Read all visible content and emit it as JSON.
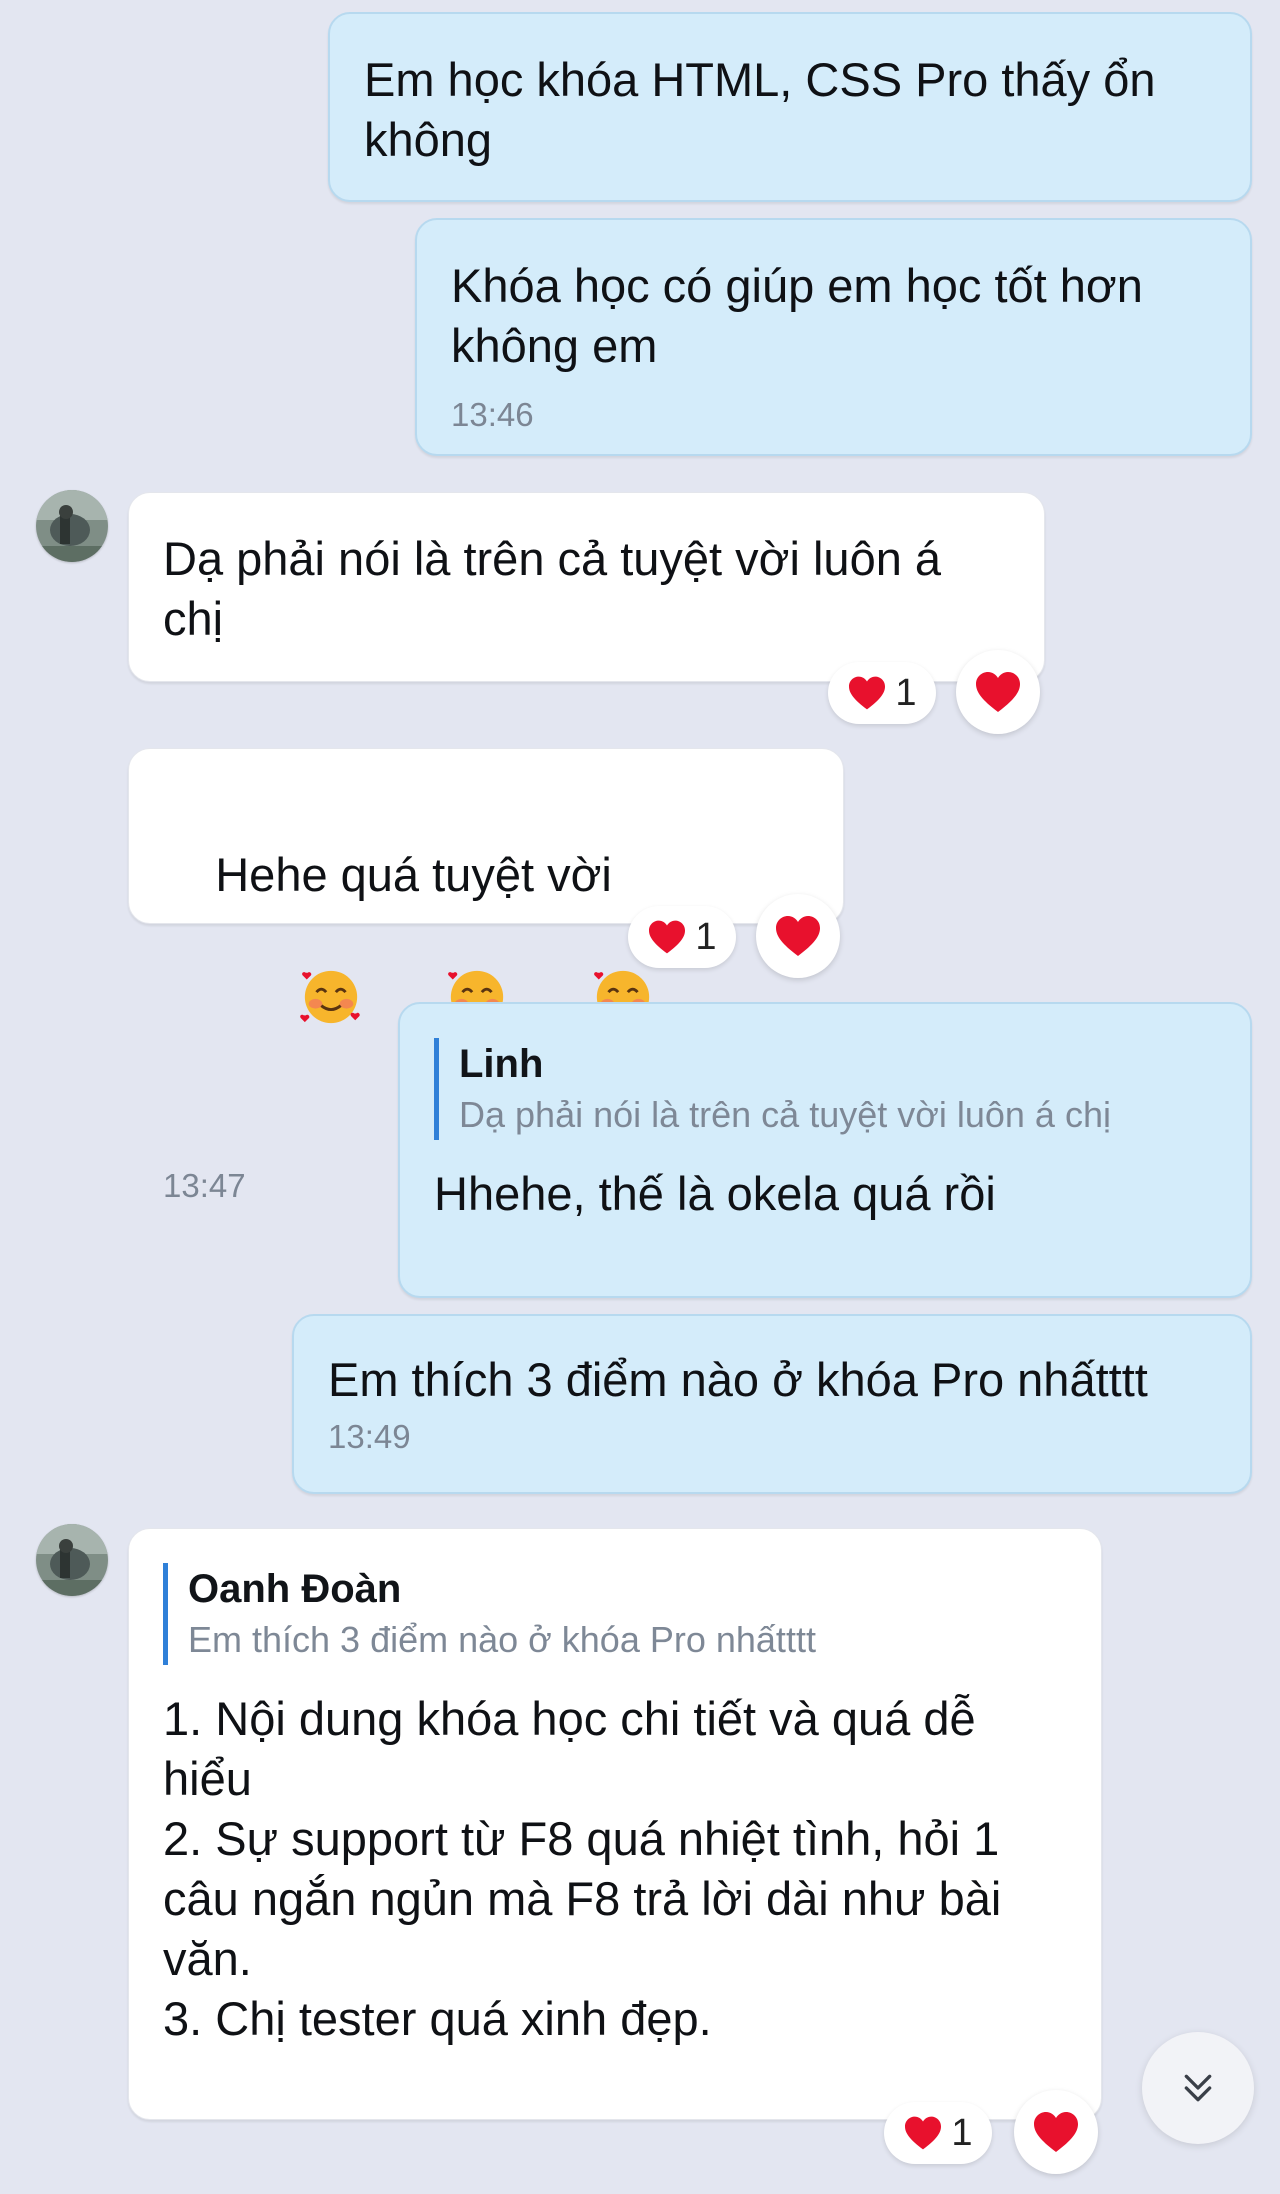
{
  "messages": {
    "m1": {
      "text": "Em học khóa HTML, CSS Pro thấy ổn\nkhông"
    },
    "m2": {
      "text": "Khóa học có giúp em học tốt hơn\nkhông em",
      "time": "13:46"
    },
    "m3": {
      "text": "Dạ phải nói là trên cả tuyệt vời luôn á\nchị",
      "reaction_count": "1"
    },
    "m4": {
      "text": "Hehe quá tuyệt vời",
      "emoji": "smiling-face-with-hearts-icon",
      "time": "13:47",
      "reaction_count": "1"
    },
    "m5": {
      "quote_name": "Linh",
      "quote_text": "Dạ phải nói là trên cả tuyệt vời luôn á chị",
      "text": "Hhehe, thế là okela quá rồi"
    },
    "m6": {
      "text": "Em thích 3 điểm nào ở khóa Pro nhấtttt",
      "time": "13:49"
    },
    "m7": {
      "quote_name": "Oanh Đoàn",
      "quote_text": "Em thích 3 điểm nào ở khóa Pro nhấtttt",
      "text": "1. Nội dung khóa học chi tiết và quá dễ\nhiểu\n2. Sự support từ F8 quá nhiệt tình, hỏi 1\ncâu ngắn ngủn mà F8 trả lời dài như bài\nvăn.\n3. Chị tester quá xinh đẹp.",
      "reaction_count": "1"
    }
  },
  "icons": {
    "reaction": "heart-icon",
    "scroll": "chevron-double-down-icon"
  },
  "colors": {
    "background": "#e3e6f1",
    "outgoing_bubble": "#d4ecfa",
    "incoming_bubble": "#ffffff",
    "quote_bar": "#2f80d8",
    "heart": "#e8112d"
  }
}
